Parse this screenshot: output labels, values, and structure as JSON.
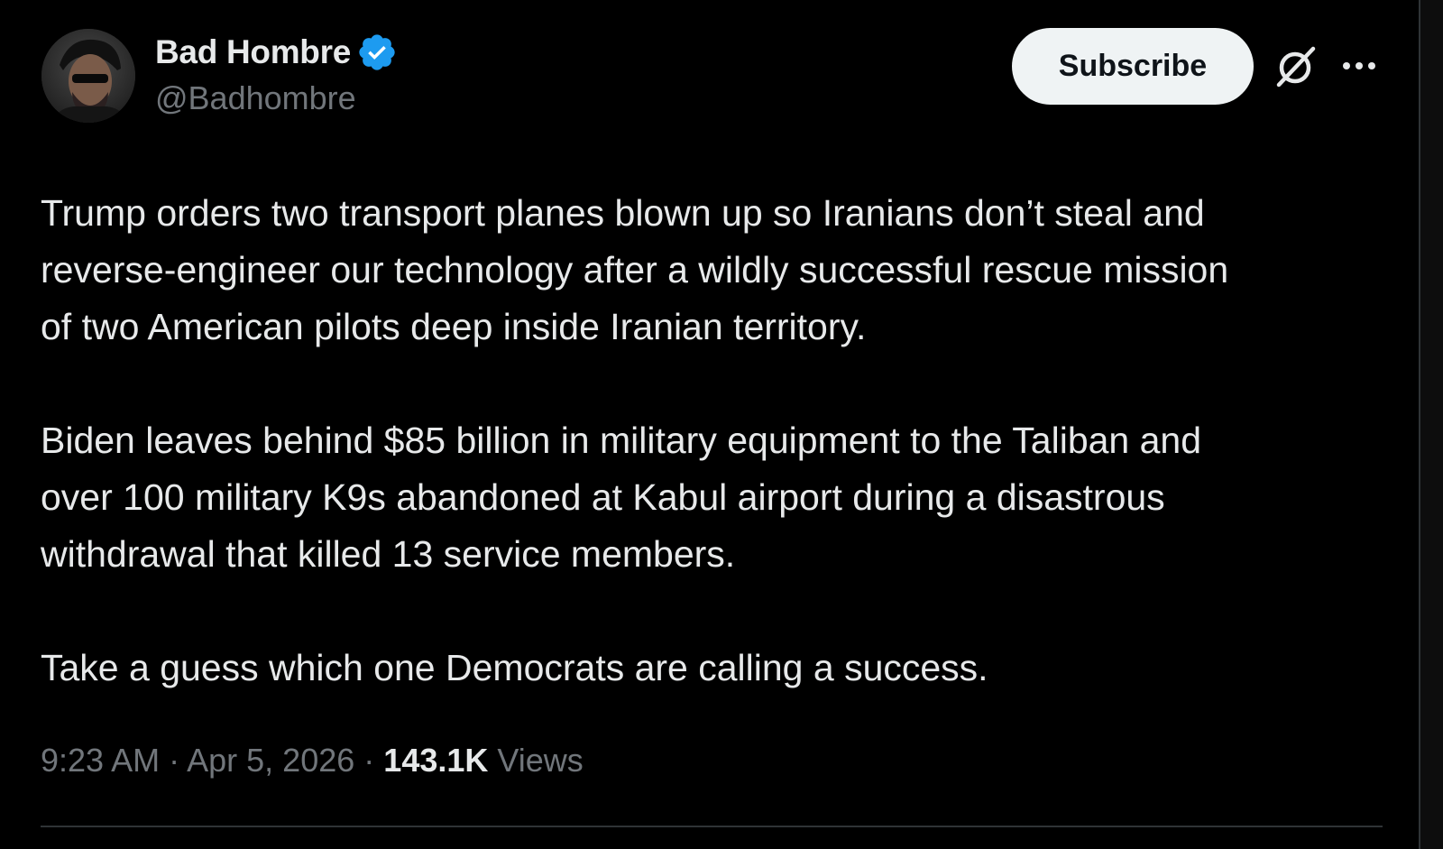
{
  "author": {
    "display_name": "Bad Hombre",
    "handle": "@Badhombre",
    "verified": true
  },
  "header": {
    "subscribe_label": "Subscribe",
    "grok_icon": "grok-icon",
    "more_icon": "more-icon"
  },
  "tweet": {
    "lines": [
      [
        "Trump orders two transport planes blown up so Iranians don’t steal and",
        "reverse-engineer our technology after a wildly successful rescue mission",
        "of two American pilots deep inside Iranian territory."
      ],
      [
        "Biden leaves behind $85 billion in military equipment to the Taliban and",
        "over 100 military K9s abandoned at Kabul airport during a disastrous",
        "withdrawal that killed 13 service members."
      ],
      [
        "Take a guess which one Democrats are calling a success."
      ]
    ]
  },
  "meta": {
    "time": "9:23 AM",
    "separator": "·",
    "date": "Apr 5, 2026",
    "views_count": "143.1K",
    "views_label": "Views"
  },
  "colors": {
    "background": "#000000",
    "text_primary": "#e7e9ea",
    "text_secondary": "#71767b",
    "verified_blue": "#1d9bf0",
    "button_bg": "#eff3f4"
  }
}
